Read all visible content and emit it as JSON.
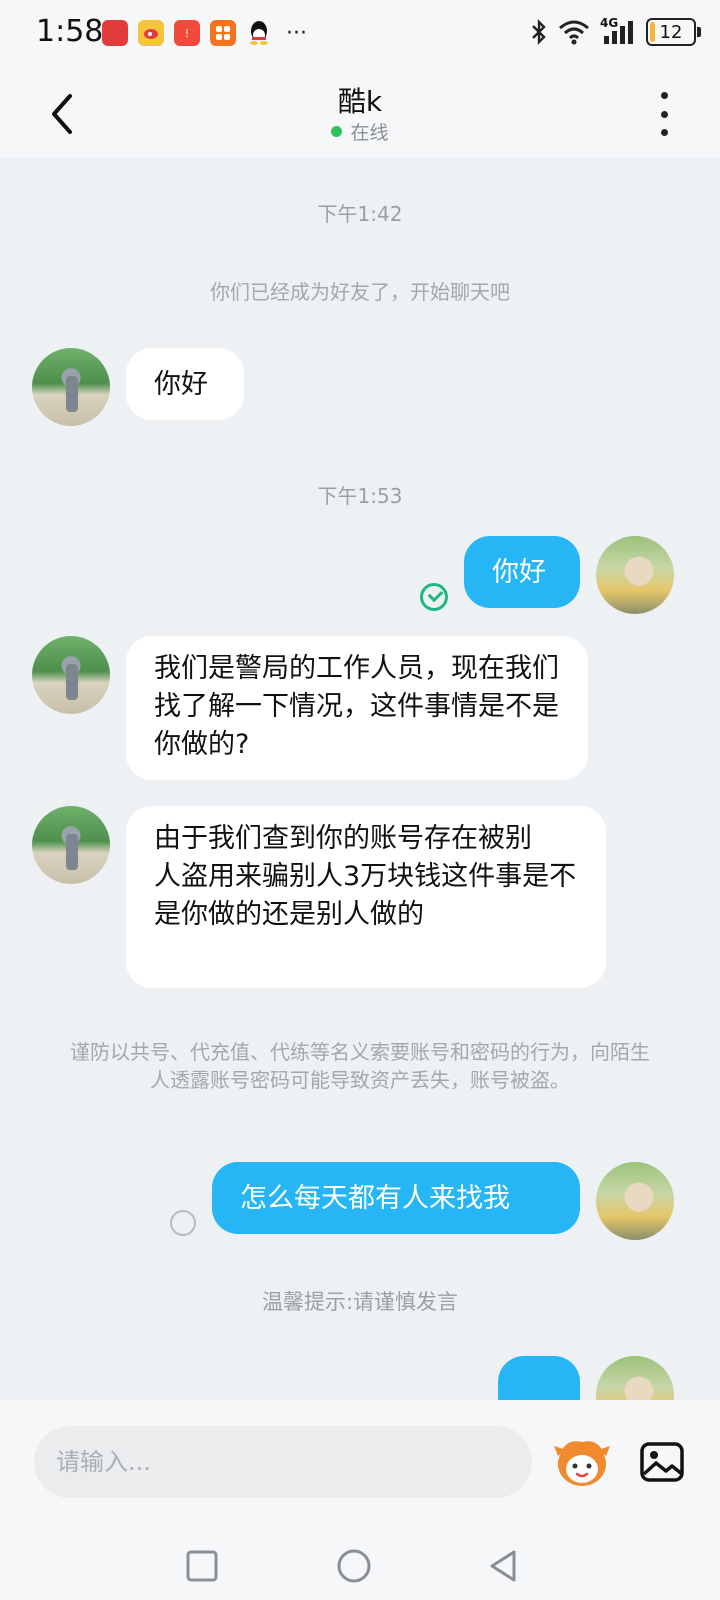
{
  "status_bar": {
    "time": "1:58",
    "more": "···",
    "network": "4G",
    "battery": "12",
    "battery_level": 0.12
  },
  "header": {
    "title": "酷k",
    "status": "在线"
  },
  "chat": {
    "timestamp_1": "下午1:42",
    "friend_notice": "你们已经成为好友了，开始聊天吧",
    "msg_1": "你好",
    "timestamp_2": "下午1:53",
    "msg_2": "你好",
    "msg_3": "我们是警局的工作人员，现在我们找了解一下情况，这件事情是不是你做的?",
    "msg_4": "由于我们查到你的账号存在被别\n人盗用来骗别人3万块钱这件事是不是你做的还是别人做的",
    "warning": "谨防以共号、代充值、代练等名义索要账号和密码的行为，向陌生人透露账号密码可能导致资产丢失，账号被盗。",
    "msg_5": "怎么每天都有人来找我",
    "tip": "温馨提示:请谨慎发言"
  },
  "input": {
    "placeholder": "请输入..."
  },
  "icons": {
    "back": "chevron-left-icon",
    "more": "more-vertical-icon",
    "emoji": "emoji-face-icon",
    "image": "image-icon",
    "nav_recent": "square-icon",
    "nav_home": "circle-icon",
    "nav_back": "triangle-back-icon"
  }
}
